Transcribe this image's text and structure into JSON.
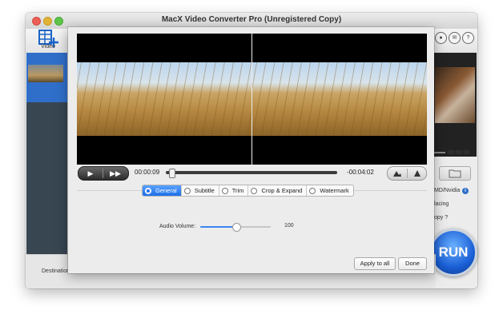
{
  "window": {
    "title": "MacX Video Converter Pro (Unregistered Copy)"
  },
  "toolbar": {
    "video_label": "Video"
  },
  "player": {
    "current_time": "00:00:09",
    "remaining_time": "-00:04:02",
    "position_fraction": 0.02
  },
  "tabs": [
    {
      "label": "General",
      "active": true
    },
    {
      "label": "Subtitle",
      "active": false
    },
    {
      "label": "Trim",
      "active": false
    },
    {
      "label": "Crop & Expand",
      "active": false
    },
    {
      "label": "Watermark",
      "active": false
    }
  ],
  "general": {
    "audio_volume_label": "Audio Volume:",
    "audio_volume_value": "100",
    "volume_fraction": 0.5
  },
  "buttons": {
    "apply_to_all": "Apply to all",
    "done": "Done"
  },
  "main": {
    "destination_label": "Destination",
    "right_time": "00:00:00",
    "hw_label": "MD/Nvidia",
    "deinterlacing_label": "lacing",
    "copy_label": "opy ?",
    "run_label": "RUN"
  },
  "colors": {
    "accent": "#1d6fe8",
    "sidebar": "#384652"
  }
}
